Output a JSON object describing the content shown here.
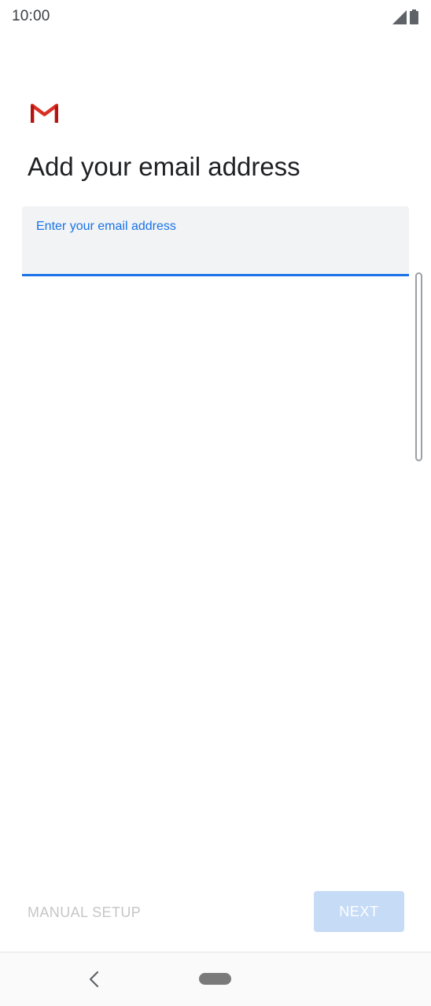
{
  "status_bar": {
    "time": "10:00",
    "signal_icon": "signal-icon",
    "battery_icon": "battery-icon"
  },
  "app": {
    "logo_icon": "gmail-logo-icon"
  },
  "page": {
    "title": "Add your email address"
  },
  "email_field": {
    "label": "Enter your email address",
    "value": "",
    "placeholder": ""
  },
  "actions": {
    "manual_setup_label": "MANUAL SETUP",
    "next_label": "NEXT"
  },
  "nav": {
    "back_icon": "back-chevron-icon",
    "home_icon": "home-pill-icon"
  },
  "colors": {
    "accent": "#1a73e8",
    "field_bg": "#f1f3f4",
    "disabled_button_bg": "#c6dbf6",
    "disabled_text": "#c4c7c5",
    "gmail_red": "#d93025"
  }
}
